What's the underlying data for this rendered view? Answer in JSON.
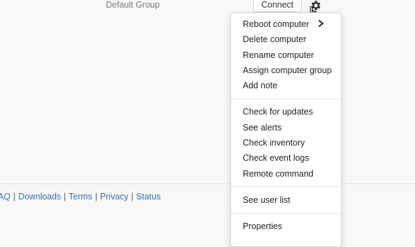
{
  "row": {
    "group_name": "Default Group",
    "connect_label": "Connect"
  },
  "footer": {
    "clipped_prefix": "AQ",
    "links": [
      "Downloads",
      "Terms",
      "Privacy",
      "Status"
    ],
    "separator": "|"
  },
  "menu": {
    "items": [
      "Reboot computer",
      "Delete computer",
      "Rename computer",
      "Assign computer group",
      "Add note",
      "Check for updates",
      "See alerts",
      "Check inventory",
      "Check event logs",
      "Remote command",
      "See user list",
      "Properties"
    ]
  },
  "icons": {
    "settings": "gear-icon",
    "pointer": "hand-pointer-cursor-icon",
    "submenu": "chevron-right-icon"
  },
  "colors": {
    "link": "#2f6fb3",
    "menu_text": "#222222",
    "background": "#f8f8f8"
  }
}
